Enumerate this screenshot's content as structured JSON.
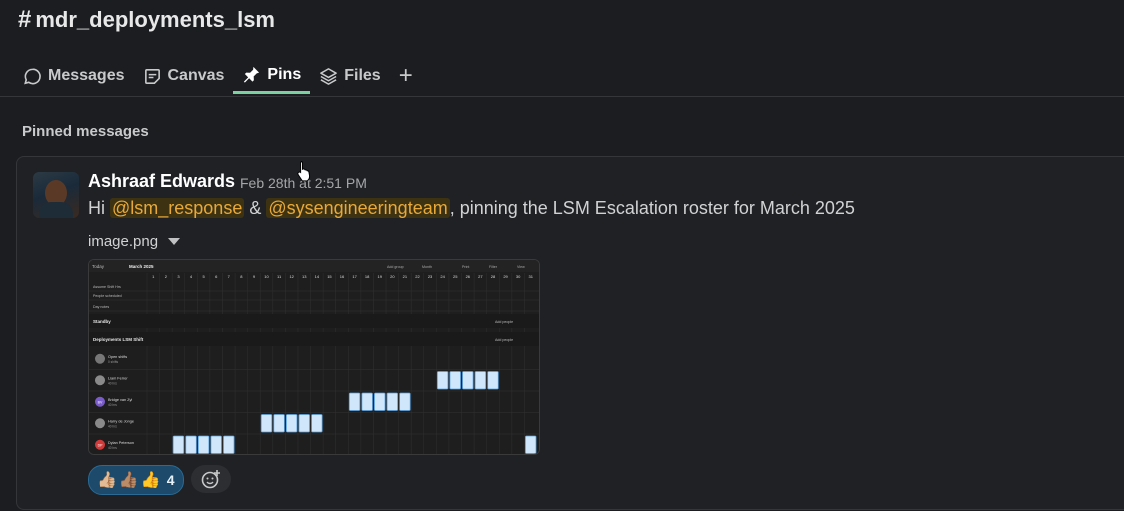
{
  "channel": {
    "hash": "#",
    "name": "mdr_deployments_lsm"
  },
  "tabs": [
    {
      "label": "Messages",
      "icon": "message-icon"
    },
    {
      "label": "Canvas",
      "icon": "canvas-icon"
    },
    {
      "label": "Pins",
      "icon": "pin-icon",
      "active": true
    },
    {
      "label": "Files",
      "icon": "layers-icon"
    }
  ],
  "section_title": "Pinned messages",
  "message": {
    "author": "Ashraaf Edwards",
    "timestamp": "Feb 28th at 2:51 PM",
    "text_hi": "Hi ",
    "mention1": "@lsm_response",
    "text_and": " & ",
    "mention2": "@sysengineeringteam",
    "text_rest": ", pinning the LSM Escalation roster for March 2025",
    "attachment_name": "image.png",
    "reaction_count": "4",
    "reaction_emojis": [
      "👍🏼",
      "👍🏽",
      "👍"
    ]
  },
  "roster": {
    "toolbar_today": "Today",
    "toolbar_month": "March 2025",
    "toolbar_items": [
      "Add group",
      "Month",
      "Print",
      "Filter",
      "View"
    ],
    "days": [
      "1",
      "2",
      "3",
      "4",
      "5",
      "6",
      "7",
      "8",
      "9",
      "10",
      "11",
      "12",
      "13",
      "14",
      "15",
      "16",
      "17",
      "18",
      "19",
      "20",
      "21",
      "22",
      "23",
      "24",
      "25",
      "26",
      "27",
      "28",
      "29",
      "30",
      "31"
    ],
    "row_labels": [
      "Assume Shift Hrs",
      "People scheduled",
      "Day notes"
    ],
    "group_standby": "Standby",
    "group_deploy": "Deployments LSM Shift",
    "add_people": "Add people",
    "people": [
      {
        "name": "Open shifts",
        "sub": "0 shifts",
        "color": "#777777",
        "initials": ""
      },
      {
        "name": "Liam Ferrer",
        "sub": "40 hrs",
        "color": "#8a8a8a",
        "initials": ""
      },
      {
        "name": "Bridge van Zyl",
        "sub": "40 hrs",
        "color": "#7a5cc8",
        "initials": "BV"
      },
      {
        "name": "Harry de Jonge",
        "sub": "40 hrs",
        "color": "#8a8a8a",
        "initials": ""
      },
      {
        "name": "Dylan Peterson",
        "sub": "40 hrs",
        "color": "#d23a3a",
        "initials": "DP"
      }
    ],
    "shifts": [
      {
        "person": 1,
        "days": [
          24,
          25,
          26,
          27,
          28
        ]
      },
      {
        "person": 2,
        "days": [
          17,
          18,
          19,
          20,
          21
        ]
      },
      {
        "person": 3,
        "days": [
          10,
          11,
          12,
          13,
          14
        ]
      },
      {
        "person": 4,
        "days": [
          3,
          4,
          5,
          6,
          7,
          31
        ]
      }
    ]
  }
}
